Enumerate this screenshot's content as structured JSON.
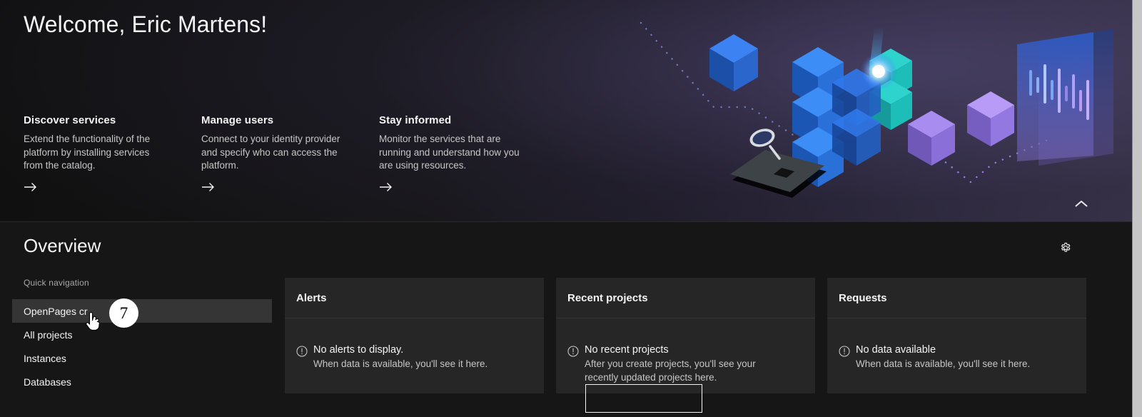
{
  "hero": {
    "title": "Welcome, Eric Martens!",
    "collapse_icon": "chevron-up-icon",
    "cards": [
      {
        "title": "Discover services",
        "body": "Extend the functionality of the platform by installing services from the catalog.",
        "arrow_icon": "arrow-right-icon"
      },
      {
        "title": "Manage users",
        "body": "Connect to your identity provider and specify who can access the platform.",
        "arrow_icon": "arrow-right-icon"
      },
      {
        "title": "Stay informed",
        "body": "Monitor the services that are running and understand how you are using resources.",
        "arrow_icon": "arrow-right-icon"
      }
    ]
  },
  "overview": {
    "title": "Overview",
    "settings_icon": "gear-icon",
    "quick_navigation": {
      "label": "Quick navigation",
      "items": [
        {
          "label": "OpenPages cr",
          "active": true
        },
        {
          "label": "All projects",
          "active": false
        },
        {
          "label": "Instances",
          "active": false
        },
        {
          "label": "Databases",
          "active": false
        }
      ]
    },
    "tiles": [
      {
        "title": "Alerts",
        "empty_icon": "warning-circle-icon",
        "empty_title": "No alerts to display.",
        "empty_body": "When data is available, you'll see it here.",
        "button": null
      },
      {
        "title": "Recent projects",
        "empty_icon": "warning-circle-icon",
        "empty_title": "No recent projects",
        "empty_body": "After you create projects, you'll see your recently updated projects here.",
        "button": ""
      },
      {
        "title": "Requests",
        "empty_icon": "warning-circle-icon",
        "empty_title": "No data available",
        "empty_body": "When data is available, you'll see it here.",
        "button": null
      }
    ]
  },
  "annotation": {
    "step_number": "7",
    "cursor_icon": "pointer-hand-cursor"
  },
  "colors": {
    "background": "#161616",
    "tile": "#262626",
    "active_nav": "#353535",
    "text_primary": "#f4f4f4",
    "text_secondary": "#c6c6c6",
    "badge_bg": "#ffffff",
    "accent_blue": "#2f6fe4",
    "accent_teal": "#22b8bf",
    "accent_purple": "#9a7ee8"
  }
}
